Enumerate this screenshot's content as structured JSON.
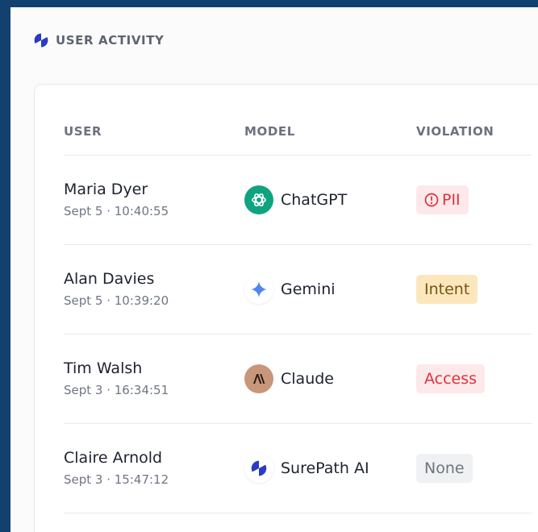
{
  "header": {
    "title": "USER ACTIVITY"
  },
  "table": {
    "columns": [
      "USER",
      "MODEL",
      "VIOLATION"
    ],
    "rows": [
      {
        "user": "Maria Dyer",
        "time": "Sept 5 · 10:40:55",
        "model": "ChatGPT",
        "model_icon": "chatgpt-icon",
        "violation": "PII",
        "violation_icon": "alert-circle-icon"
      },
      {
        "user": "Alan Davies",
        "time": "Sept 5 · 10:39:20",
        "model": "Gemini",
        "model_icon": "gemini-sparkle-icon",
        "violation": "Intent"
      },
      {
        "user": "Tim Walsh",
        "time": "Sept 3 · 16:34:51",
        "model": "Claude",
        "model_icon": "claude-icon",
        "violation": "Access"
      },
      {
        "user": "Claire Arnold",
        "time": "Sept 3 · 15:47:12",
        "model": "SurePath AI",
        "model_icon": "surepath-icon",
        "violation": "None"
      }
    ]
  },
  "colors": {
    "background": "#124170",
    "chatgpt": "#10a37f",
    "claude": "#c8967a",
    "gemini": "#4f86f2",
    "surepath": "#2a3bc4",
    "danger": "#e0303e",
    "warning_bg": "#fce7bd"
  }
}
